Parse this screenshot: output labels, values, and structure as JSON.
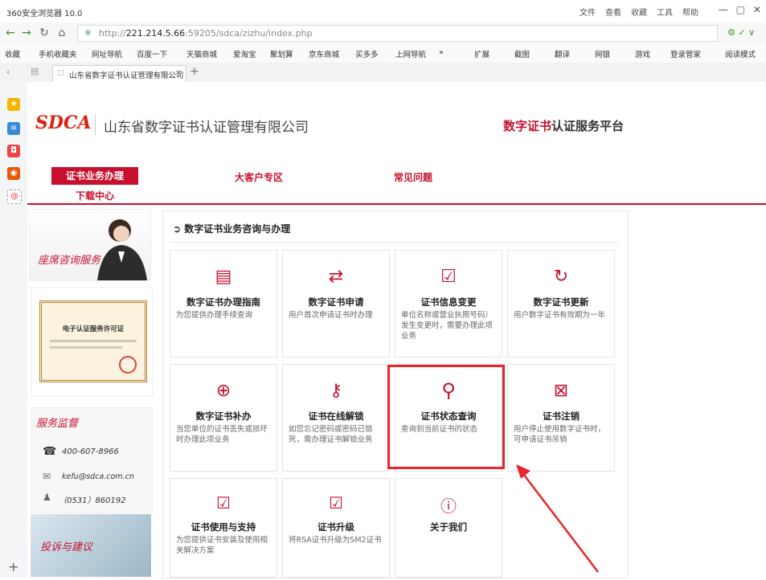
{
  "browser": {
    "title": "360安全浏览器 10.0",
    "menus": [
      "文件",
      "查看",
      "收藏",
      "工具",
      "帮助"
    ],
    "url_prefix": "http://",
    "url_host": "221.214.5.66",
    "url_rest": ":59205/sdca/zizhu/index.php",
    "favorites": [
      "收藏",
      "手机收藏夹",
      "网址导航",
      "百度一下",
      "天猫商城",
      "爱淘宝",
      "聚划算",
      "京东商城",
      "买多多",
      "上网导航",
      "»"
    ],
    "fav_right": [
      "扩展",
      "截图",
      "翻译",
      "网银",
      "游戏",
      "登录管家",
      "阅读模式"
    ],
    "tab_title": "山东省数字证书认证管理有限公司"
  },
  "header": {
    "logo_text": "SDCA",
    "company_name": "山东省数字证书认证管理有限公司",
    "platform_highlight": "数字证书",
    "platform_rest": "认证服务平台"
  },
  "nav": {
    "items": [
      "证书业务办理",
      "大客户专区",
      "常见问题"
    ],
    "download": "下载中心"
  },
  "left": {
    "service_label": "座席咨询服务",
    "license_title": "电子认证服务许可证",
    "supervision_title": "服务监督",
    "phone": "400-607-8966",
    "email": "kefu@sdca.com.cn",
    "local_phone": "（0531）860192",
    "complaint": "投诉与建议"
  },
  "main": {
    "heading": "数字证书业务咨询与办理",
    "cards": [
      {
        "title": "数字证书办理指南",
        "desc": "为您提供办理手续查询",
        "icon": "document-icon"
      },
      {
        "title": "数字证书申请",
        "desc": "用户首次申请证书时办理",
        "icon": "exchange-icon"
      },
      {
        "title": "证书信息变更",
        "desc": "单位名称或营业执照号码）发生变更时，需要办理此项业务",
        "icon": "doc-check-icon"
      },
      {
        "title": "数字证书更新",
        "desc": "用户数字证书有效期为一年",
        "icon": "refresh-icon"
      },
      {
        "title": "数字证书补办",
        "desc": "当您单位的证书丢失或损坏时办理此项业务",
        "icon": "doc-plus-icon"
      },
      {
        "title": "证书在线解锁",
        "desc": "如您忘记密码或密码已锁死，需办理证书解锁业务",
        "icon": "key-icon"
      },
      {
        "title": "证书状态查询",
        "desc": "查询到当前证书的状态",
        "icon": "search-icon"
      },
      {
        "title": "证书注销",
        "desc": "用户停止使用数字证书时，可申请证书吊销",
        "icon": "cancel-doc-icon"
      },
      {
        "title": "证书使用与支持",
        "desc": "为您提供证书安装及使用相关解决方案",
        "icon": "support-icon"
      },
      {
        "title": "证书升级",
        "desc": "将RSA证书升级为SM2证书",
        "icon": "upgrade-icon"
      },
      {
        "title": "关于我们",
        "desc": "",
        "icon": "info-icon"
      }
    ]
  },
  "colors": {
    "brand_red": "#c8102e",
    "highlight_red": "#e8262b"
  }
}
